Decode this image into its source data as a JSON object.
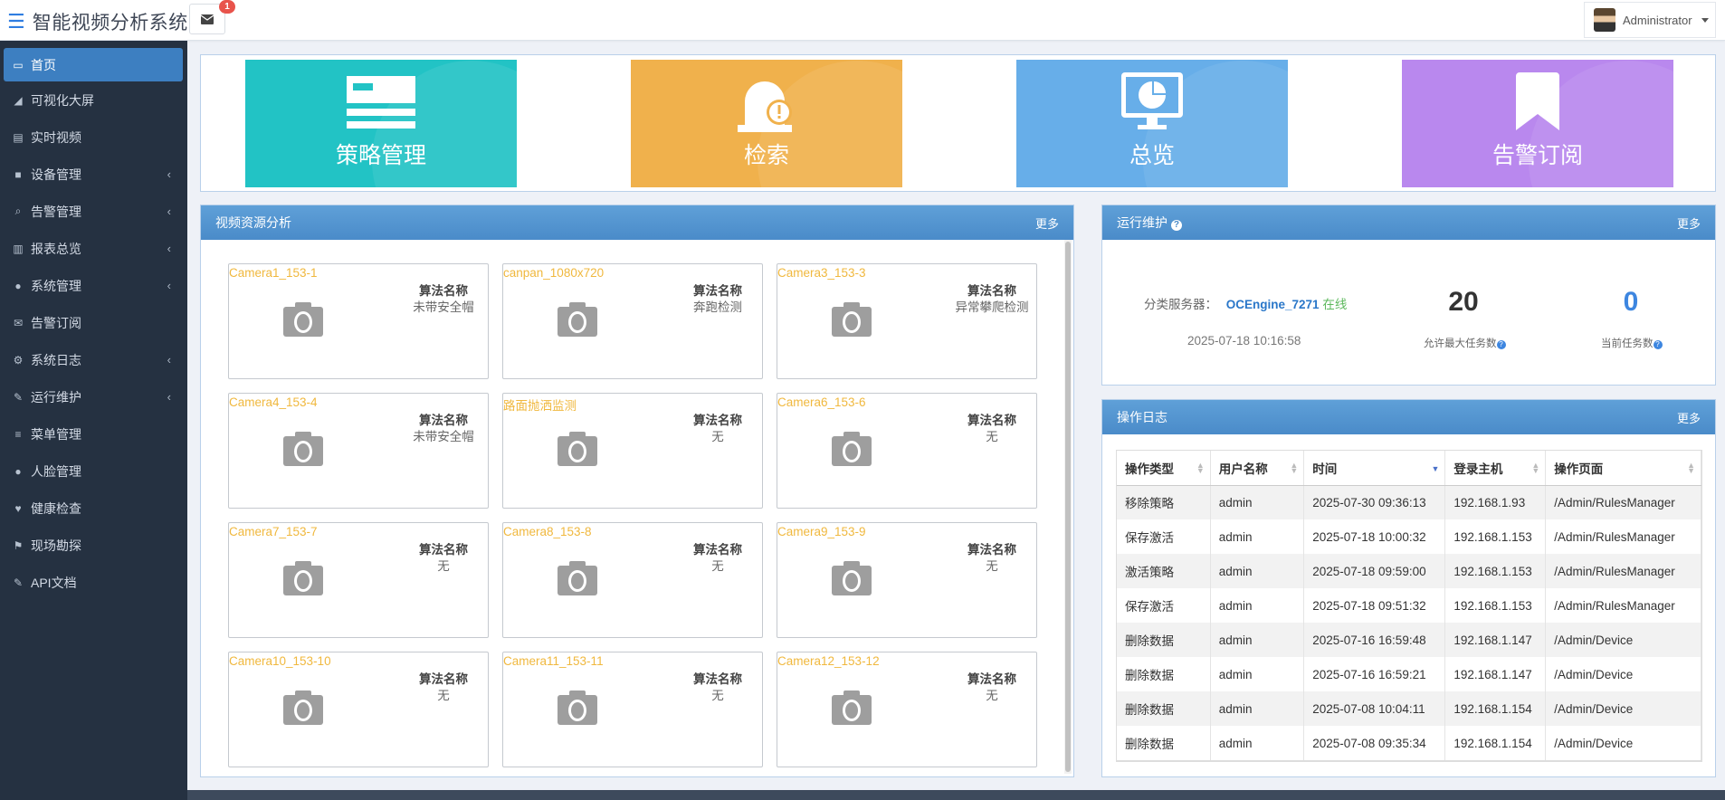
{
  "header": {
    "app_title": "智能视频分析系统",
    "notification_count": "1",
    "user_name": "Administrator"
  },
  "sidebar": {
    "items": [
      {
        "label": "首页",
        "icon": "monitor-icon",
        "active": true
      },
      {
        "label": "可视化大屏",
        "icon": "area-chart-icon"
      },
      {
        "label": "实时视频",
        "icon": "film-icon"
      },
      {
        "label": "设备管理",
        "icon": "video-camera-icon",
        "expandable": true
      },
      {
        "label": "告警管理",
        "icon": "search-icon",
        "expandable": true
      },
      {
        "label": "报表总览",
        "icon": "bar-chart-icon",
        "expandable": true
      },
      {
        "label": "系统管理",
        "icon": "user-circle-icon",
        "expandable": true
      },
      {
        "label": "告警订阅",
        "icon": "envelope-icon"
      },
      {
        "label": "系统日志",
        "icon": "cogs-icon",
        "expandable": true
      },
      {
        "label": "运行维护",
        "icon": "wrench-icon",
        "expandable": true
      },
      {
        "label": "菜单管理",
        "icon": "bars-icon"
      },
      {
        "label": "人脸管理",
        "icon": "users-icon"
      },
      {
        "label": "健康检查",
        "icon": "heartbeat-icon"
      },
      {
        "label": "现场勘探",
        "icon": "flag-icon"
      },
      {
        "label": "API文档",
        "icon": "wrench-icon"
      }
    ],
    "arrow": "‹"
  },
  "quick_cards": [
    {
      "label": "策略管理",
      "color": "#22c3c5",
      "icon": "strategy-icon"
    },
    {
      "label": "检索",
      "color": "#f0b14c",
      "icon": "alarm-bell-icon"
    },
    {
      "label": "总览",
      "color": "#67aee9",
      "icon": "monitor-pie-icon"
    },
    {
      "label": "告警订阅",
      "color": "#b988ee",
      "icon": "bookmark-icon"
    }
  ],
  "video_panel": {
    "title": "视频资源分析",
    "more": "更多",
    "algo_label": "算法名称",
    "cameras": [
      {
        "name": "Camera1_153-1",
        "algorithm": "未带安全帽"
      },
      {
        "name": "canpan_1080x720",
        "algorithm": "奔跑检测"
      },
      {
        "name": "Camera3_153-3",
        "algorithm": "异常攀爬检测"
      },
      {
        "name": "Camera4_153-4",
        "algorithm": "未带安全帽"
      },
      {
        "name": "路面抛洒监测",
        "algorithm": "无"
      },
      {
        "name": "Camera6_153-6",
        "algorithm": "无"
      },
      {
        "name": "Camera7_153-7",
        "algorithm": "无"
      },
      {
        "name": "Camera8_153-8",
        "algorithm": "无"
      },
      {
        "name": "Camera9_153-9",
        "algorithm": "无"
      },
      {
        "name": "Camera10_153-10",
        "algorithm": "无"
      },
      {
        "name": "Camera11_153-11",
        "algorithm": "无"
      },
      {
        "name": "Camera12_153-12",
        "algorithm": "无"
      }
    ]
  },
  "ops_panel": {
    "title": "运行维护",
    "help": "?",
    "more": "更多",
    "server_label": "分类服务器：",
    "server_name": "OCEngine_7271",
    "server_status": "在线",
    "timestamp": "2025-07-18 10:16:58",
    "max_tasks": "20",
    "max_tasks_label": "允许最大任务数",
    "current_tasks": "0",
    "current_tasks_label": "当前任务数"
  },
  "log_panel": {
    "title": "操作日志",
    "more": "更多",
    "columns": [
      "操作类型",
      "用户名称",
      "时间",
      "登录主机",
      "操作页面"
    ],
    "rows": [
      [
        "移除策略",
        "admin",
        "2025-07-30 09:36:13",
        "192.168.1.93",
        "/Admin/RulesManager"
      ],
      [
        "保存激活",
        "admin",
        "2025-07-18 10:00:32",
        "192.168.1.153",
        "/Admin/RulesManager"
      ],
      [
        "激活策略",
        "admin",
        "2025-07-18 09:59:00",
        "192.168.1.153",
        "/Admin/RulesManager"
      ],
      [
        "保存激活",
        "admin",
        "2025-07-18 09:51:32",
        "192.168.1.153",
        "/Admin/RulesManager"
      ],
      [
        "删除数据",
        "admin",
        "2025-07-16 16:59:48",
        "192.168.1.147",
        "/Admin/Device"
      ],
      [
        "删除数据",
        "admin",
        "2025-07-16 16:59:21",
        "192.168.1.147",
        "/Admin/Device"
      ],
      [
        "删除数据",
        "admin",
        "2025-07-08 10:04:11",
        "192.168.1.154",
        "/Admin/Device"
      ],
      [
        "删除数据",
        "admin",
        "2025-07-08 09:35:34",
        "192.168.1.154",
        "/Admin/Device"
      ]
    ]
  },
  "colors": {
    "sidebar_bg": "#253141",
    "accent": "#3d7fc1",
    "camera_name": "#f0b83e",
    "online": "#5cb85c",
    "current_tasks": "#3d86e0"
  }
}
